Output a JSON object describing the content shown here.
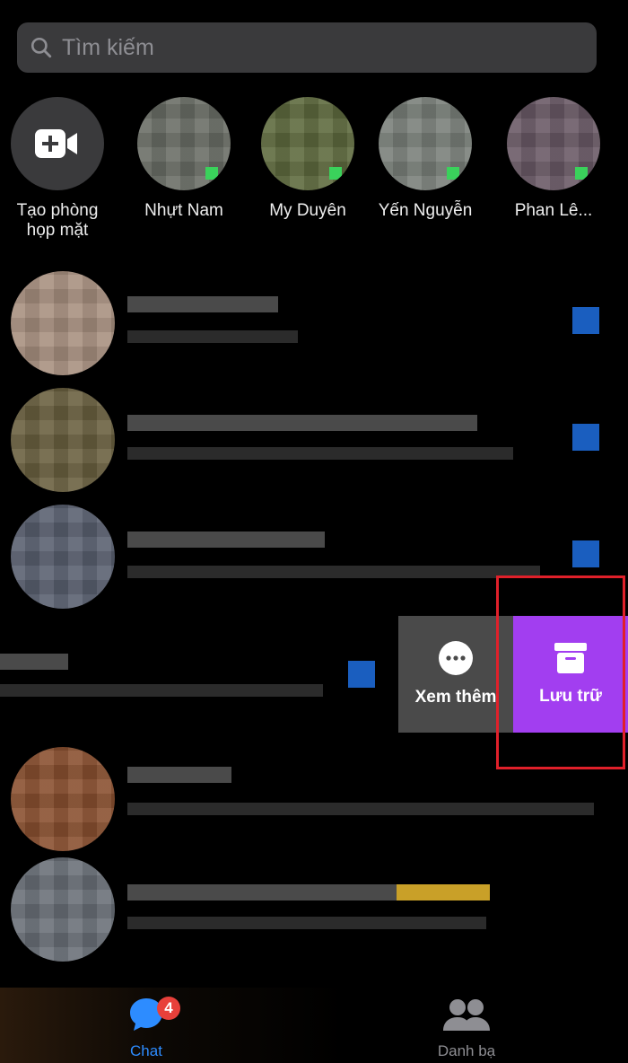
{
  "search": {
    "placeholder": "Tìm kiếm"
  },
  "stories": [
    {
      "label": "Tạo phòng họp mặt",
      "icon": "video-plus-icon"
    },
    {
      "label": "Nhựt Nam",
      "online": true
    },
    {
      "label": "My Duyên",
      "online": true
    },
    {
      "label": "Yến Nguyễn",
      "online": true
    },
    {
      "label": "Phan Lê...",
      "online": true
    }
  ],
  "swipe_actions": {
    "more_label": "Xem thêm",
    "archive_label": "Lưu trữ",
    "archive_color": "#a23ef0"
  },
  "tabbar": {
    "chat_label": "Chat",
    "chat_badge": "4",
    "contacts_label": "Danh bạ",
    "active_color": "#2d8cff"
  }
}
